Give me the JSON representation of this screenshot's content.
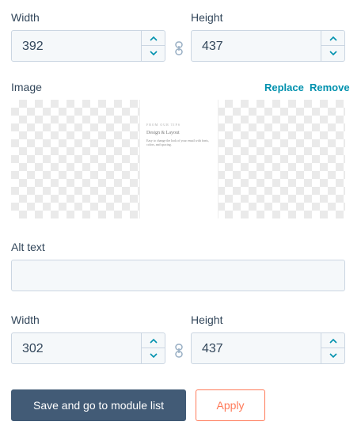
{
  "top_dims": {
    "width_label": "Width",
    "width_value": "392",
    "height_label": "Height",
    "height_value": "437"
  },
  "image": {
    "label": "Image",
    "replace_label": "Replace",
    "remove_label": "Remove",
    "preview": {
      "kicker": "FROM OUR TIPS",
      "heading": "Design & Layout",
      "body": "Easy to change the look of your email with fonts, colors, and spacing."
    }
  },
  "alt_text": {
    "label": "Alt text",
    "value": "",
    "placeholder": ""
  },
  "bottom_dims": {
    "width_label": "Width",
    "width_value": "302",
    "height_label": "Height",
    "height_value": "437"
  },
  "buttons": {
    "save_label": "Save and go to module list",
    "apply_label": "Apply"
  },
  "icons": {
    "increment": "chevron-up-icon",
    "decrement": "chevron-down-icon",
    "aspect_lock": "link-icon"
  },
  "colors": {
    "accent_link": "#0091ae",
    "primary_button": "#425b76",
    "secondary_button": "#ff7a59",
    "field_bg": "#f5f8fa",
    "field_border": "#cbd6e2",
    "text": "#33475b"
  }
}
